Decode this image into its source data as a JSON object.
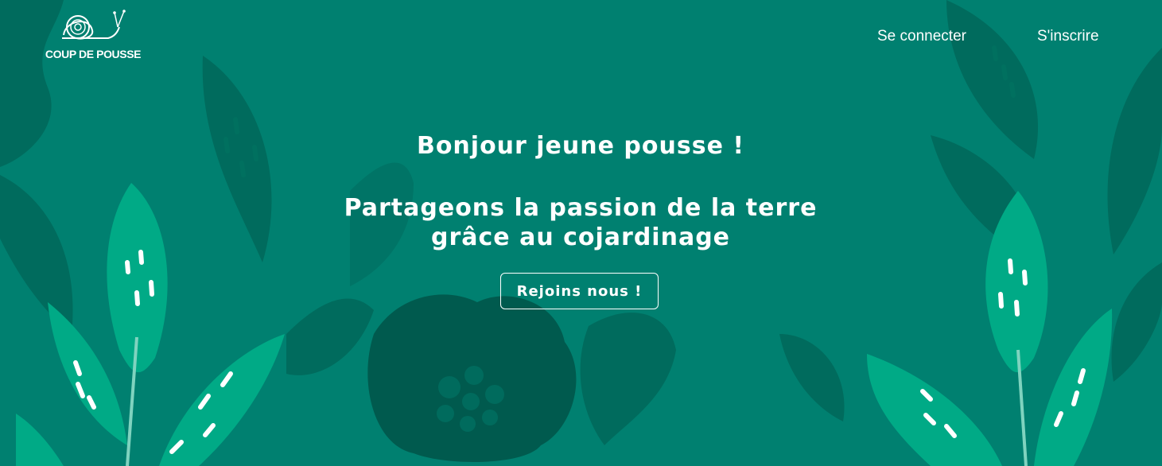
{
  "header": {
    "logo_text": "COUP DE POUSSE",
    "logo_icon": "snail-icon",
    "nav": [
      {
        "label": "Se connecter"
      },
      {
        "label": "S'inscrire"
      }
    ]
  },
  "hero": {
    "title": "Bonjour jeune pousse !",
    "subtitle": "Partageons la passion de la terre grâce au cojardinage",
    "cta_label": "Rejoins nous !"
  },
  "colors": {
    "background": "#008070",
    "leaf_dark": "#006b5d",
    "leaf_darker": "#005a4e",
    "leaf_bright": "#00aa86",
    "text": "#ffffff"
  }
}
